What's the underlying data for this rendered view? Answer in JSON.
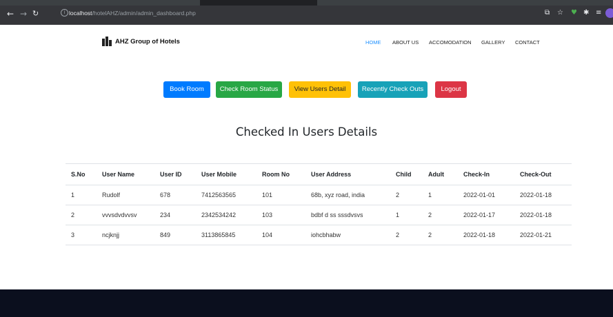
{
  "browser": {
    "url_host": "localhost",
    "url_path": "/hotelAHZ/admin/admin_dashboard.php"
  },
  "header": {
    "logo_text": "AHZ Group of Hotels",
    "menu": [
      "HOME",
      "ABOUT US",
      "ACCOMODATION",
      "GALLERY",
      "CONTACT"
    ],
    "active_menu": "HOME"
  },
  "actions": {
    "book_room": "Book Room",
    "check_room_status": "Check Room Status",
    "view_users_detail": "View Users Detail",
    "recently_check_outs": "Recently Check Outs",
    "logout": "Logout"
  },
  "page_title": "Checked In Users Details",
  "table": {
    "columns": [
      "S.No",
      "User Name",
      "User ID",
      "User Mobile",
      "Room No",
      "User Address",
      "Child",
      "Adult",
      "Check-In",
      "Check-Out"
    ],
    "rows": [
      [
        "1",
        "Rudolf",
        "678",
        "7412563565",
        "101",
        "68b, xyz road, india",
        "2",
        "1",
        "2022-01-01",
        "2022-01-18"
      ],
      [
        "2",
        "vvvsdvdvvsv",
        "234",
        "2342534242",
        "103",
        "bdbf d ss sssdvsvs",
        "1",
        "2",
        "2022-01-17",
        "2022-01-18"
      ],
      [
        "3",
        "ncjknjj",
        "849",
        "3113865845",
        "104",
        "iohcbhabw",
        "2",
        "2",
        "2022-01-18",
        "2022-01-21"
      ]
    ]
  },
  "colors": {
    "primary": "#007bff",
    "success": "#28a745",
    "warning": "#ffc107",
    "info": "#17a2b8",
    "danger": "#dc3545",
    "footer": "#0b0f1e",
    "active_link": "#1e90ff"
  }
}
